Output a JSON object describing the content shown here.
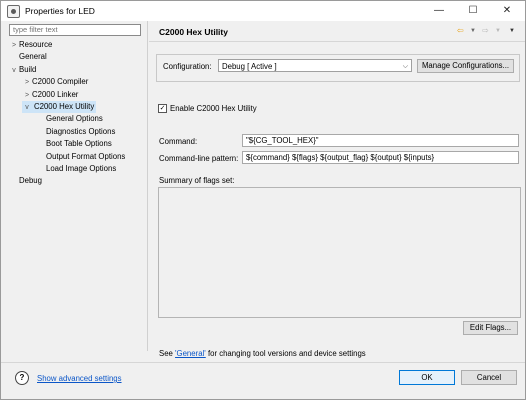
{
  "window": {
    "title": "Properties for LED",
    "minimize": "—",
    "maximize": "☐",
    "close": "✕"
  },
  "filter": {
    "placeholder": "type filter text"
  },
  "tree": [
    {
      "label": "Resource",
      "toggle": ">",
      "level": 0
    },
    {
      "label": "General",
      "toggle": "",
      "level": 0
    },
    {
      "label": "Build",
      "toggle": "v",
      "level": 0
    },
    {
      "label": "C2000 Compiler",
      "toggle": ">",
      "level": 1
    },
    {
      "label": "C2000 Linker",
      "toggle": ">",
      "level": 1
    },
    {
      "label": "C2000 Hex Utility",
      "toggle": "v",
      "level": 1,
      "selected": true
    },
    {
      "label": "General Options",
      "toggle": "",
      "level": 2
    },
    {
      "label": "Diagnostics Options",
      "toggle": "",
      "level": 2
    },
    {
      "label": "Boot Table Options",
      "toggle": "",
      "level": 2
    },
    {
      "label": "Output Format Options",
      "toggle": "",
      "level": 2
    },
    {
      "label": "Load Image Options",
      "toggle": "",
      "level": 2
    },
    {
      "label": "Debug",
      "toggle": "",
      "level": 0
    }
  ],
  "page": {
    "title": "C2000 Hex Utility",
    "configuration_label": "Configuration:",
    "configuration_value": "Debug  [ Active ]",
    "manage_button": "Manage Configurations...",
    "enable_label": "Enable C2000 Hex Utility",
    "enable_checked": "✓",
    "command_label": "Command:",
    "command_value": "\"${CG_TOOL_HEX}\"",
    "pattern_label": "Command-line pattern:",
    "pattern_value": "${command} ${flags} ${output_flag} ${output} ${inputs}",
    "summary_label": "Summary of flags set:",
    "edit_flags_button": "Edit Flags...",
    "see_text": "See",
    "general_link": "'General'",
    "see_rest": "for changing tool versions and device settings"
  },
  "footer": {
    "show_advanced": "Show advanced settings",
    "ok": "OK",
    "cancel": "Cancel"
  },
  "colors": {
    "accent": "#0b56c8",
    "selection": "#cde4f7",
    "nav_arrow": "#e8a317"
  }
}
